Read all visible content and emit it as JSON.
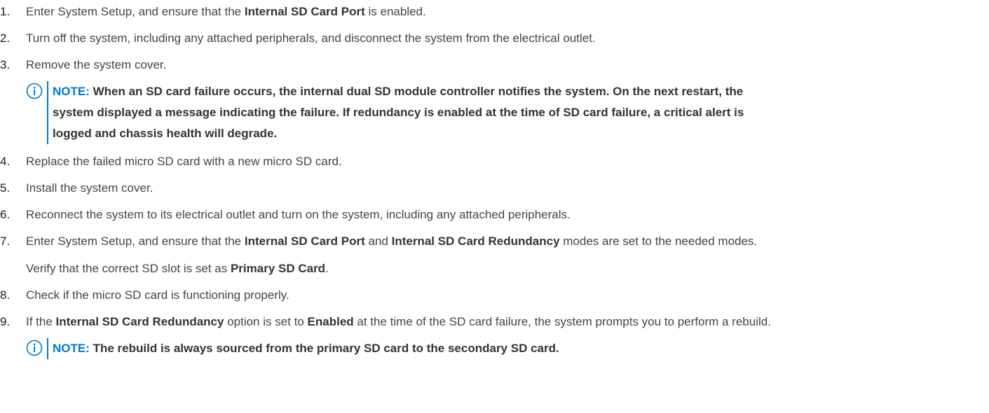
{
  "steps": [
    {
      "num": "1.",
      "parts": [
        {
          "t": "Enter System Setup, and ensure that the ",
          "b": false
        },
        {
          "t": "Internal SD Card Port",
          "b": true
        },
        {
          "t": " is enabled.",
          "b": false
        }
      ]
    },
    {
      "num": "2.",
      "parts": [
        {
          "t": "Turn off the system, including any attached peripherals, and disconnect the system from the electrical outlet.",
          "b": false
        }
      ]
    },
    {
      "num": "3.",
      "parts": [
        {
          "t": "Remove the system cover.",
          "b": false
        }
      ]
    },
    {
      "num": "4.",
      "parts": [
        {
          "t": "Replace the failed micro SD card with a new micro SD card.",
          "b": false
        }
      ]
    },
    {
      "num": "5.",
      "parts": [
        {
          "t": "Install the system cover.",
          "b": false
        }
      ]
    },
    {
      "num": "6.",
      "parts": [
        {
          "t": "Reconnect the system to its electrical outlet and turn on the system, including any attached peripherals.",
          "b": false
        }
      ]
    },
    {
      "num": "7.",
      "parts": [
        {
          "t": "Enter System Setup, and ensure that the ",
          "b": false
        },
        {
          "t": "Internal SD Card Port",
          "b": true
        },
        {
          "t": " and ",
          "b": false
        },
        {
          "t": "Internal SD Card Redundancy",
          "b": true
        },
        {
          "t": " modes are set to the needed modes.",
          "b": false
        }
      ],
      "para": [
        {
          "t": "Verify that the correct SD slot is set as ",
          "b": false
        },
        {
          "t": "Primary SD Card",
          "b": true
        },
        {
          "t": ".",
          "b": false
        }
      ]
    },
    {
      "num": "8.",
      "parts": [
        {
          "t": "Check if the micro SD card is functioning properly.",
          "b": false
        }
      ]
    },
    {
      "num": "9.",
      "parts": [
        {
          "t": "If the ",
          "b": false
        },
        {
          "t": "Internal SD Card Redundancy",
          "b": true
        },
        {
          "t": " option is set to ",
          "b": false
        },
        {
          "t": "Enabled",
          "b": true
        },
        {
          "t": " at the time of the SD card failure, the system prompts you to perform a rebuild.",
          "b": false
        }
      ]
    }
  ],
  "notes": {
    "note1": {
      "label": "NOTE:",
      "text": " When an SD card failure occurs, the internal dual SD module controller notifies the system. On the next restart, the system displayed a message indicating the failure. If redundancy is enabled at the time of SD card failure, a critical alert is logged and chassis health will degrade."
    },
    "note2": {
      "label": "NOTE:",
      "text": " The rebuild is always sourced from the primary SD card to the secondary SD card."
    }
  },
  "icons": {
    "note": "info-circle-icon"
  },
  "colors": {
    "accent": "#0076ce",
    "text": "#444444"
  }
}
